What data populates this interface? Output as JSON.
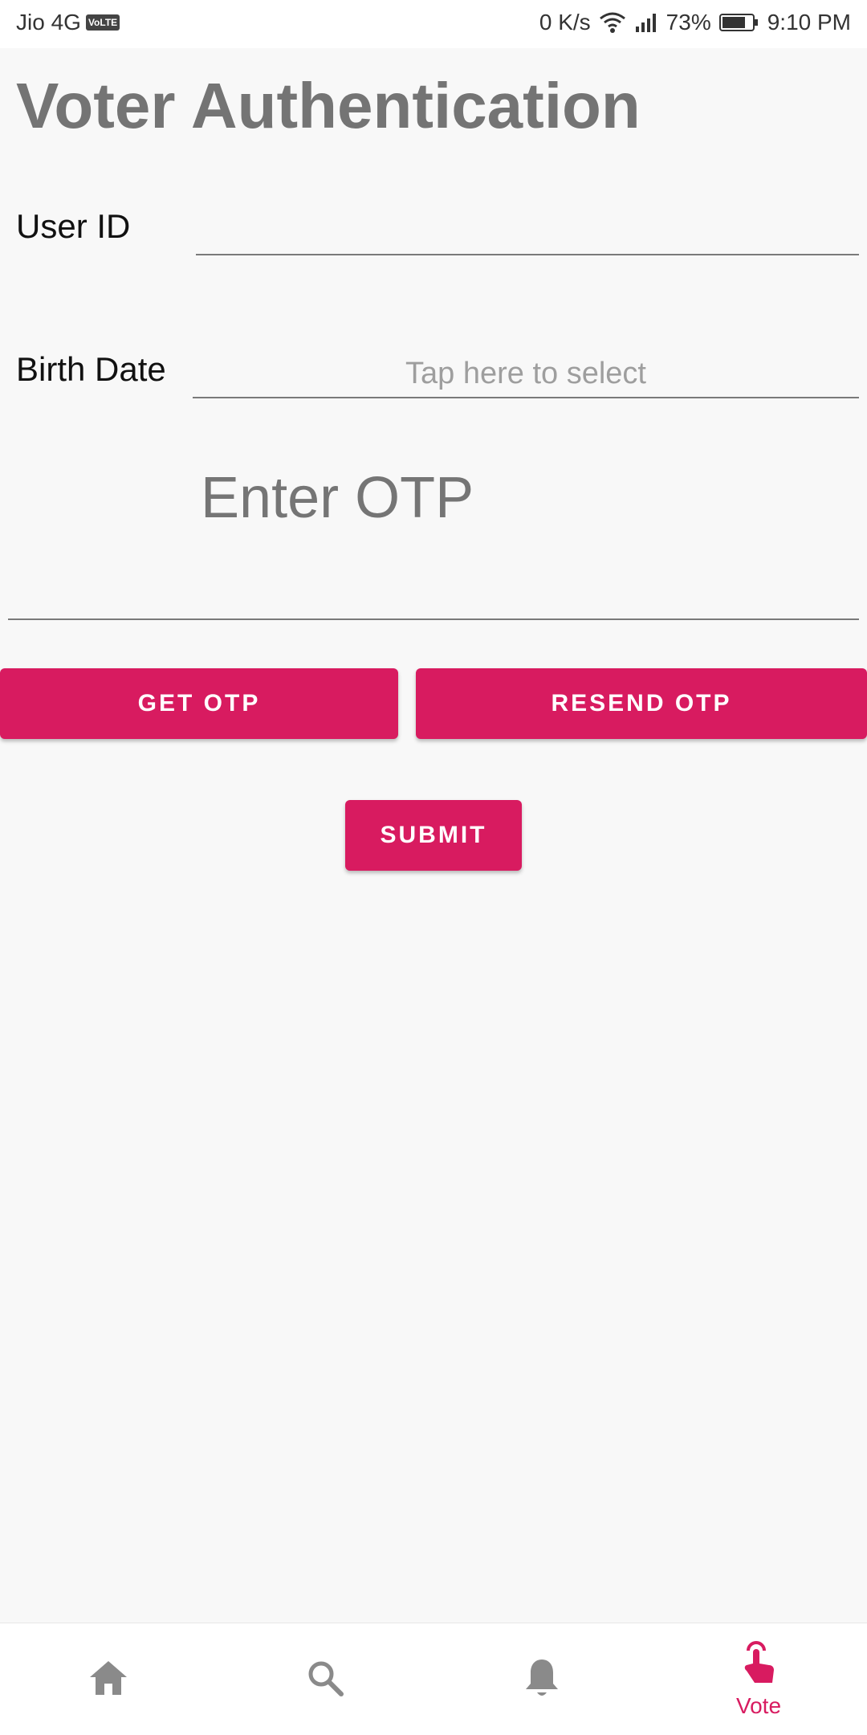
{
  "status_bar": {
    "carrier": "Jio 4G",
    "volte": "VoLTE",
    "net_speed": "0 K/s",
    "battery": "73%",
    "time": "9:10 PM"
  },
  "page": {
    "title": "Voter Authentication"
  },
  "form": {
    "user_id_label": "User ID",
    "user_id_value": "",
    "birth_date_label": "Birth Date",
    "birth_date_placeholder": "Tap here to select",
    "otp_placeholder": "Enter OTP"
  },
  "buttons": {
    "get_otp": "GET OTP",
    "resend_otp": "RESEND OTP",
    "submit": "SUBMIT"
  },
  "bottom_nav": {
    "items": [
      {
        "icon": "home-icon",
        "label": ""
      },
      {
        "icon": "search-icon",
        "label": ""
      },
      {
        "icon": "bell-icon",
        "label": ""
      },
      {
        "icon": "touch-icon",
        "label": "Vote",
        "active": true
      }
    ]
  },
  "colors": {
    "accent": "#d81b60",
    "inactive_icon": "#8a8a8a",
    "title": "#747474",
    "background": "#f8f8f8"
  }
}
